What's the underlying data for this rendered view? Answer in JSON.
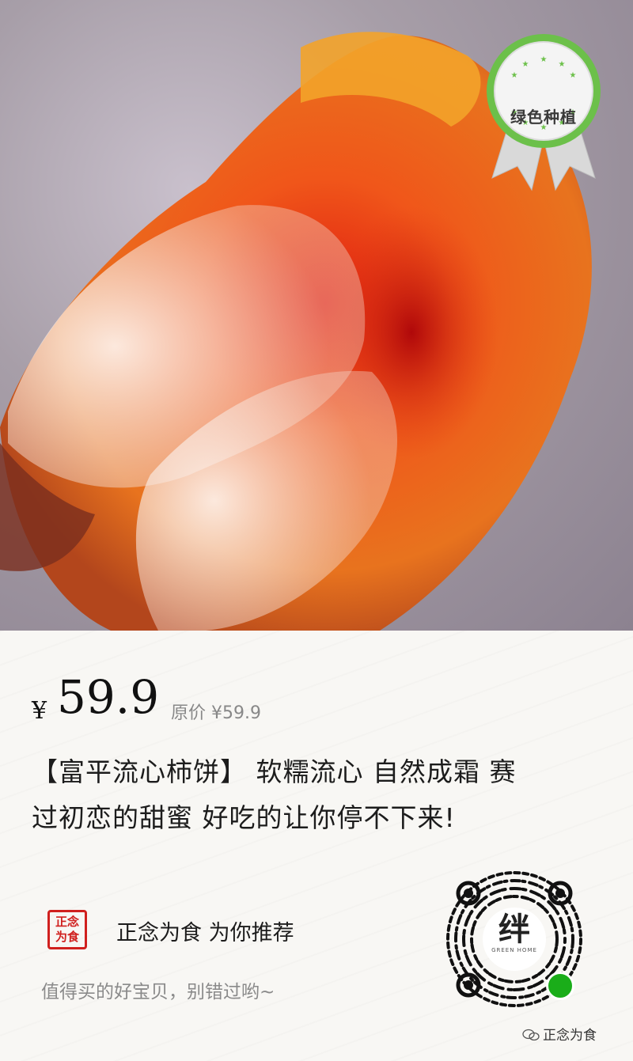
{
  "badge": {
    "label": "绿色种植"
  },
  "product": {
    "currency": "¥",
    "price": "59.9",
    "original_price": "原价 ¥59.9",
    "title_line1": "【富平流心柿饼】 软糯流心 自然成霜 赛",
    "title_line2": "过初恋的甜蜜 好吃的让你停不下来!"
  },
  "shop": {
    "seal_text_top": "正念",
    "seal_text_bottom": "为食",
    "recommend": "正念为食 为你推荐",
    "slogan": "值得买的好宝贝，别错过哟~"
  },
  "qr": {
    "center_char": "绊",
    "center_sub": "GREEN HOME"
  },
  "watermark": {
    "text": "正念为食"
  },
  "colors": {
    "seal_red": "#d0201e",
    "badge_green": "#6cc04a",
    "accent_orange": "#e8541a"
  }
}
